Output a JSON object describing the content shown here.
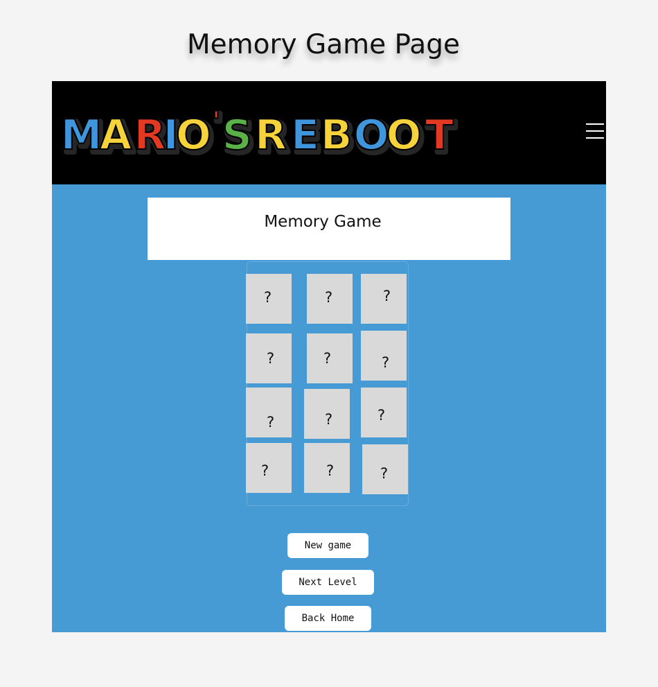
{
  "page": {
    "heading": "Memory Game Page"
  },
  "navbar": {
    "logo_text": "MARIO'S REBOOT",
    "logo_letters": [
      "M",
      "A",
      "R",
      "I",
      "O",
      "'",
      "S",
      " ",
      "R",
      "E",
      "B",
      "O",
      "O",
      "T"
    ],
    "logo_colors": [
      "#3f96dc",
      "#f7d33b",
      "#e23a22",
      "#3f96dc",
      "#f7d33b",
      "#e23a22",
      "#5ab148",
      "",
      "#f7d33b",
      "#3f96dc",
      "#f7d33b",
      "#3f96dc",
      "#f7d33b",
      "#e23a22"
    ],
    "menu_icon": "hamburger-icon"
  },
  "game": {
    "title": "Memory Game",
    "cards": [
      {
        "face": "?"
      },
      {
        "face": "?"
      },
      {
        "face": "?"
      },
      {
        "face": "?"
      },
      {
        "face": "?"
      },
      {
        "face": "?"
      },
      {
        "face": "?"
      },
      {
        "face": "?"
      },
      {
        "face": "?"
      },
      {
        "face": "?"
      },
      {
        "face": "?"
      },
      {
        "face": "?"
      }
    ]
  },
  "buttons": {
    "new_game": "New game",
    "next_level": "Next Level",
    "back_home": "Back Home"
  },
  "colors": {
    "page_background": "#f4f4f4",
    "navbar_background": "#000000",
    "game_background": "#479bd5",
    "card_background": "#d9d9d9"
  }
}
